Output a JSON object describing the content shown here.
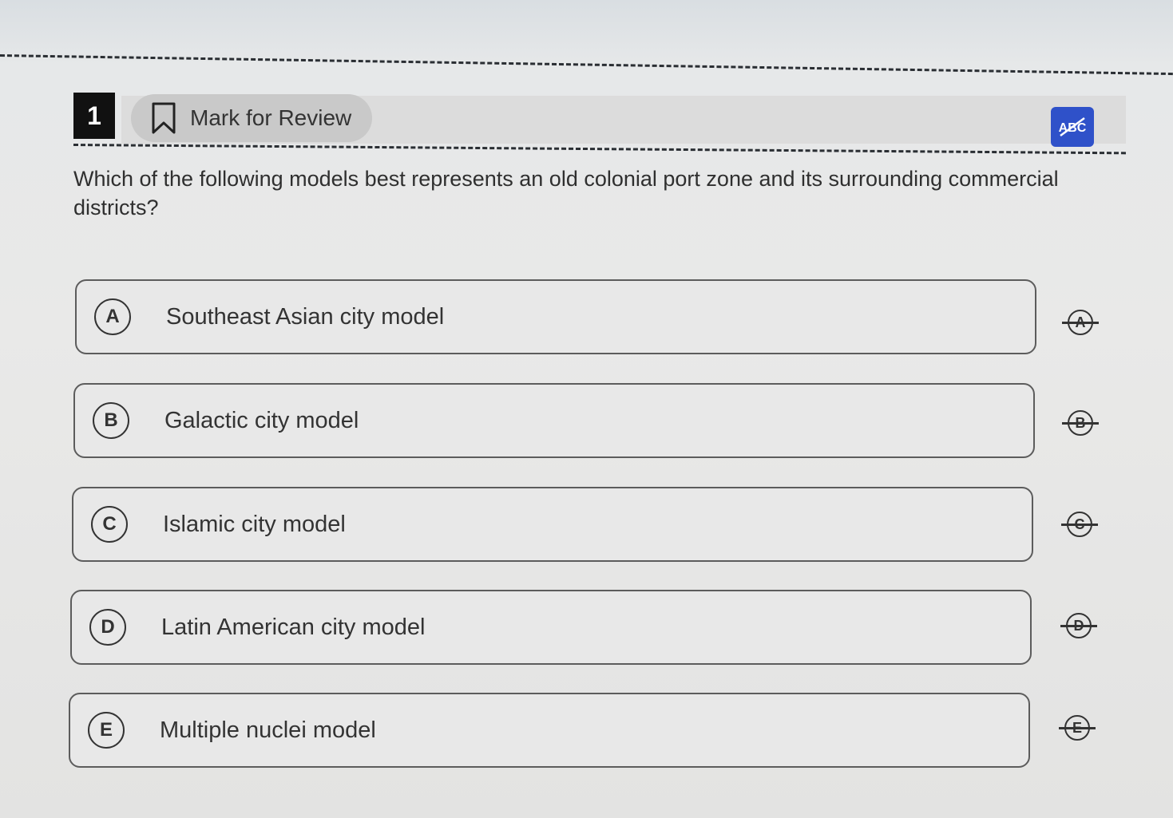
{
  "question": {
    "number": "1",
    "mark_for_review_label": "Mark for Review",
    "abc_button_label": "ABC",
    "text": "Which of the following models best represents an old colonial port zone and its surrounding commercial districts?"
  },
  "choices": [
    {
      "letter": "A",
      "text": "Southeast Asian city model"
    },
    {
      "letter": "B",
      "text": "Galactic city model"
    },
    {
      "letter": "C",
      "text": "Islamic city model"
    },
    {
      "letter": "D",
      "text": "Latin American city model"
    },
    {
      "letter": "E",
      "text": "Multiple nuclei model"
    }
  ],
  "colors": {
    "accent": "#2f51c9",
    "question_number_bg": "#111111"
  },
  "icons": {
    "mark_for_review": "bookmark-icon",
    "abc_toggle": "abc-strikethrough-icon",
    "eliminate": "strikethrough-letter-icon"
  }
}
